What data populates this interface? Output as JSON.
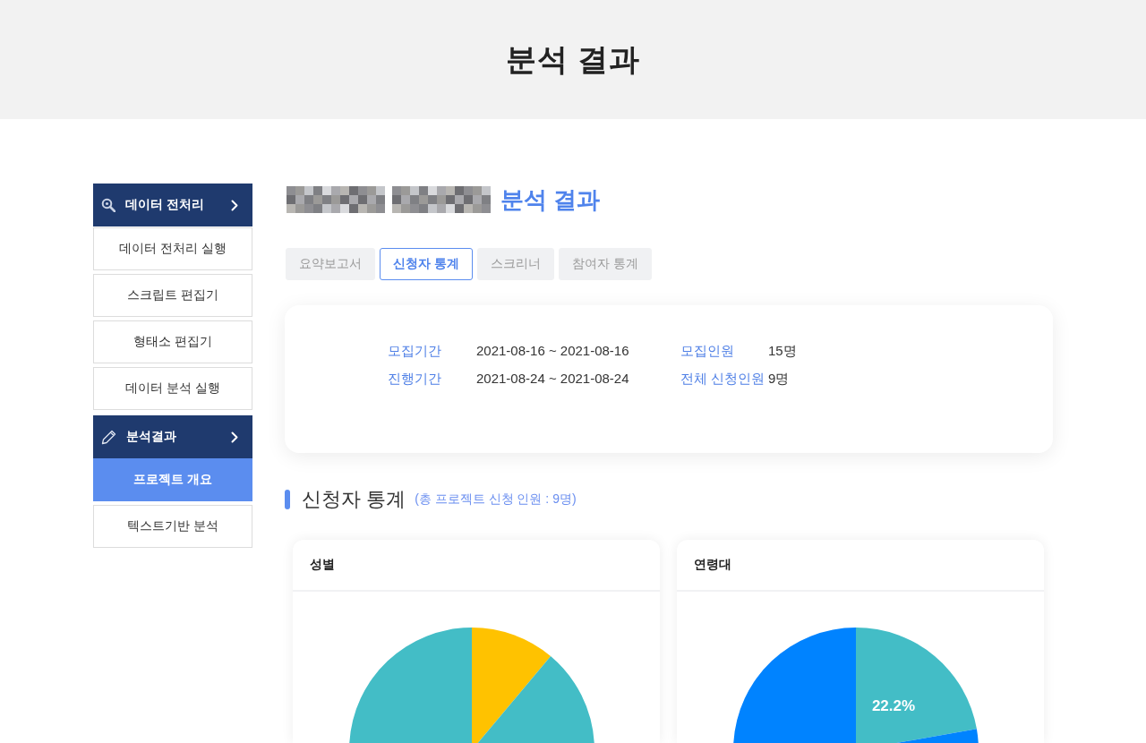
{
  "header": {
    "title": "분석 결과"
  },
  "sidebar": {
    "groups": [
      {
        "title": "데이터 전처리",
        "items": [
          {
            "label": "데이터 전처리 실행",
            "selected": false
          },
          {
            "label": "스크립트 편집기",
            "selected": false
          },
          {
            "label": "형태소 편집기",
            "selected": false
          },
          {
            "label": "데이터 분석 실행",
            "selected": false
          }
        ]
      },
      {
        "title": "분석결과",
        "items": [
          {
            "label": "프로젝트 개요",
            "selected": true
          },
          {
            "label": "텍스트기반 분석",
            "selected": false
          }
        ]
      }
    ]
  },
  "page_title": {
    "text": "분석 결과"
  },
  "tabs": [
    {
      "label": "요약보고서",
      "selected": false
    },
    {
      "label": "신청자 통계",
      "selected": true
    },
    {
      "label": "스크리너",
      "selected": false
    },
    {
      "label": "참여자 통계",
      "selected": false
    }
  ],
  "info_card": {
    "fields": [
      {
        "label": "모집기간",
        "value": "2021-08-16 ~ 2021-08-16"
      },
      {
        "label": "모집인원",
        "value": "15명"
      },
      {
        "label": "진행기간",
        "value": "2021-08-24 ~ 2021-08-24"
      },
      {
        "label": "전체 신청인원",
        "value": "9명"
      }
    ]
  },
  "section": {
    "title": "신청자 통계",
    "subtitle": "(총 프로젝트 신청 인원 : 9명)"
  },
  "charts": [
    {
      "title": "성별"
    },
    {
      "title": "연령대",
      "labels": [
        "22.2%"
      ]
    }
  ]
}
